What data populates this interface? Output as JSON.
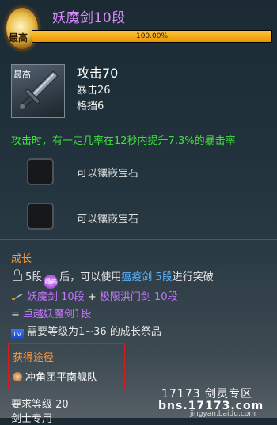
{
  "header": {
    "badge": "最高",
    "title": "妖魔剑10段",
    "progress_text": "100.00%",
    "progress": 1.0
  },
  "item": {
    "badge": "最高",
    "stat_main": "攻击70",
    "crit": "暴击26",
    "block": "格挡6"
  },
  "effect_text": "攻击时，有一定几率在12秒内提升7.3%的暴击率",
  "sockets": [
    {
      "label": "可以镶嵌宝石"
    },
    {
      "label": "可以镶嵌宝石"
    }
  ],
  "growth": {
    "title": "成长",
    "breakthrough": {
      "pre": "5段",
      "badge": "最高",
      "mid": "后，可以使用",
      "link": "瘟疫剑 5段",
      "post": "进行突破"
    },
    "materials": {
      "first": "妖魔剑 10段",
      "plus": " + ",
      "second": "极限洪门剑 10段"
    },
    "result": {
      "prefix": "= ",
      "name": "卓越妖魔剑1段"
    },
    "lv_icon": "Lv",
    "requirement": "需要等级为1~36 的成长祭品"
  },
  "source": {
    "title": "获得途径",
    "item": "冲角团平南舰队"
  },
  "requirements": {
    "level": "要求等级 20",
    "class": "剑士专用"
  },
  "watermark": {
    "line1": "17173 剑灵专区",
    "line2": "bns.17173.com",
    "line3": "jingyan.baidu.com"
  },
  "colors": {
    "title": "#d98bff",
    "effect": "#3fe03c",
    "section": "#ff9a3c",
    "link": "#5ab4ff",
    "upgrade": "#c774ff",
    "progress": "#ffb81e"
  },
  "icons": [
    "medal-icon",
    "lock-icon",
    "sword-icon",
    "level-icon",
    "source-icon"
  ]
}
